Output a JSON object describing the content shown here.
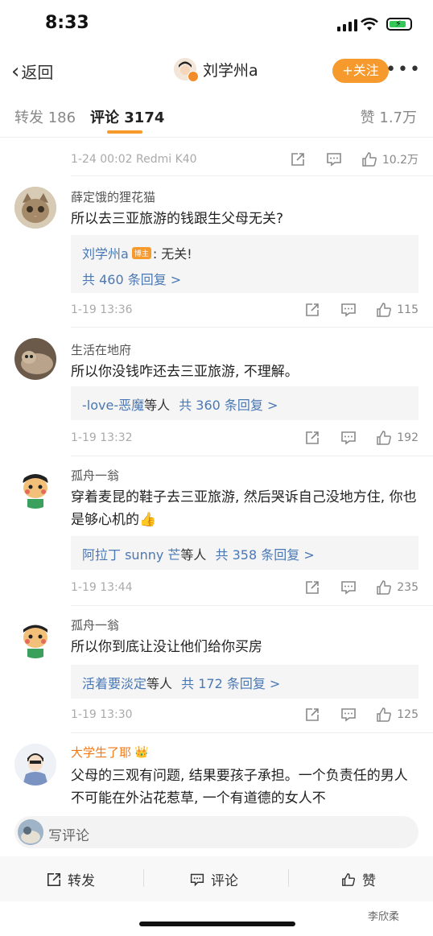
{
  "status": {
    "time": "8:33"
  },
  "nav": {
    "back": "返回",
    "username": "刘学州a",
    "follow": "+关注",
    "more": "•••"
  },
  "tabs": {
    "repost": "转发 186",
    "comments": "评论 3174",
    "likes": "赞 1.7万"
  },
  "top_meta": {
    "time": "1-24 00:02  Redmi K40",
    "likes": "10.2万"
  },
  "comments": [
    {
      "name": "薛定饿的狸花猫",
      "text": "所以去三亚旅游的钱跟生父母无关?",
      "reply_name": "刘学州a",
      "reply_badge": "博主",
      "reply_text": ": 无关!",
      "reply_count": "共 460 条回复 >",
      "time": "1-19 13:36",
      "likes": "115"
    },
    {
      "name": "生活在地府",
      "text": "所以你没钱咋还去三亚旅游, 不理解。",
      "reply_users": "-love-恶魔",
      "reply_suffix": "等人",
      "reply_count": "共 360 条回复 >",
      "time": "1-19 13:32",
      "likes": "192"
    },
    {
      "name": "孤舟一翁",
      "text": "穿着麦昆的鞋子去三亚旅游, 然后哭诉自己没地方住, 你也是够心机的👍",
      "reply_users": "阿拉丁 sunny 芒",
      "reply_suffix": "等人",
      "reply_count": "共 358 条回复 >",
      "time": "1-19 13:44",
      "likes": "235"
    },
    {
      "name": "孤舟一翁",
      "text": "所以你到底让没让他们给你买房",
      "reply_users": "活着要淡定",
      "reply_suffix": "等人",
      "reply_count": "共 172 条回复 >",
      "time": "1-19 13:30",
      "likes": "125"
    },
    {
      "name": "大学生了耶",
      "text": "父母的三观有问题, 结果要孩子承担。一个负责任的男人不可能在外沾花惹草, 一个有道德的女人不"
    }
  ],
  "compose": {
    "placeholder": "写评论"
  },
  "bottom": {
    "repost": "转发",
    "comment": "评论",
    "like": "赞"
  },
  "watermark": "李欣柔"
}
